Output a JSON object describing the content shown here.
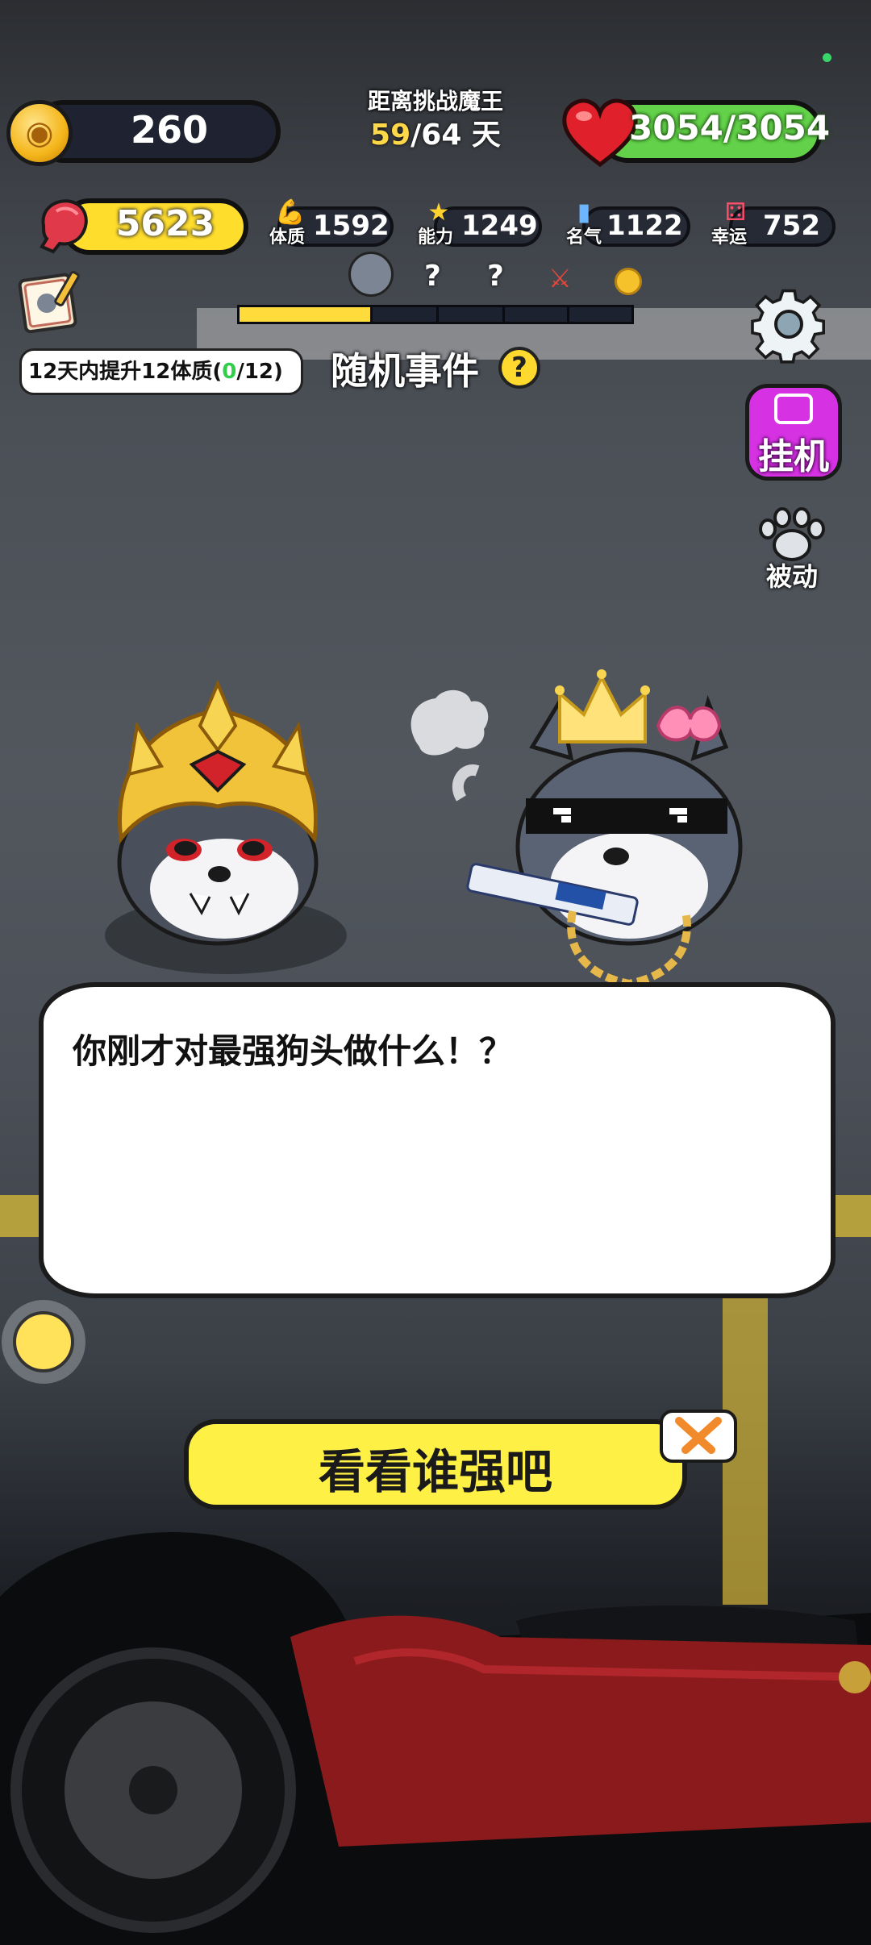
{
  "top": {
    "coins": "260",
    "countdown_title": "距离挑战魔王",
    "day_current": "59",
    "day_total": "/64 天",
    "hp": "3054/3054"
  },
  "power": {
    "value": "5623"
  },
  "stats": [
    {
      "name": "体质",
      "value": "1592",
      "icon": "arm-icon"
    },
    {
      "name": "能力",
      "value": "1249",
      "icon": "star-icon"
    },
    {
      "name": "名气",
      "value": "1122",
      "icon": "trophy-icon"
    },
    {
      "name": "幸运",
      "value": "752",
      "icon": "dice-icon"
    }
  ],
  "progress": {
    "marks": [
      "?",
      "?"
    ],
    "fill_fraction": 0.34
  },
  "quest": {
    "prefix": "12天内提升12体质(",
    "done": "0",
    "suffix": "/12)"
  },
  "random_event": {
    "label": "随机事件",
    "help": "?"
  },
  "side_buttons": {
    "idle_label": "挂机",
    "passive_label": "被动"
  },
  "dialog": {
    "text": "你刚才对最强狗头做什么！？"
  },
  "action": {
    "label": "看看谁强吧"
  },
  "colors": {
    "coin_bar": "#1f2331",
    "hp_bar": "#63d24a",
    "power_bar": "#ffdd2d",
    "idle_button": "#d632e3",
    "action_button": "#fff046"
  }
}
